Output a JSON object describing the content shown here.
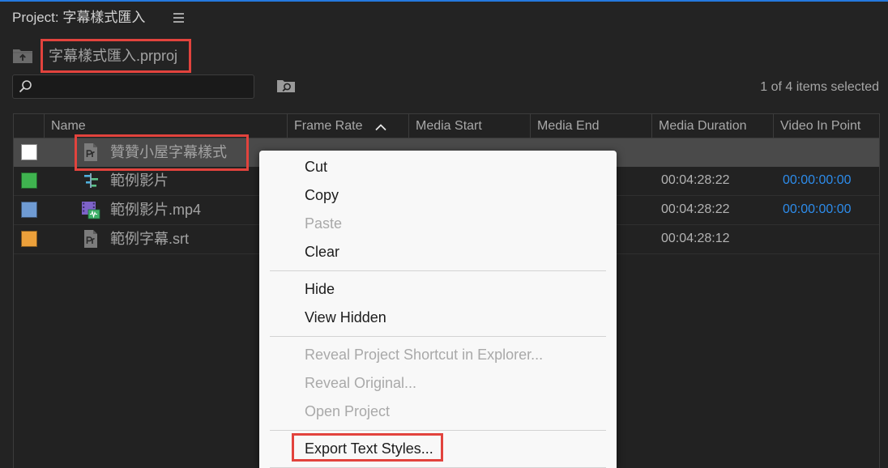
{
  "panel": {
    "title": "Project: 字幕樣式匯入",
    "menu_icon": "hamburger-menu-icon",
    "breadcrumb": {
      "icon": "parent-folder-icon",
      "label": "字幕樣式匯入.prproj",
      "annotated": true
    },
    "search": {
      "icon": "search-icon",
      "value": "",
      "placeholder": ""
    },
    "new_search_bin_icon": "new-search-bin-icon",
    "selection_status": "1 of 4 items selected"
  },
  "table": {
    "columns": [
      {
        "label": "Name"
      },
      {
        "label": "Frame Rate",
        "sort_icon": "chevron-up-icon"
      },
      {
        "label": "Media Start"
      },
      {
        "label": "Media End"
      },
      {
        "label": "Media Duration"
      },
      {
        "label": "Video In Point"
      }
    ],
    "rows": [
      {
        "label_color": "#ffffff",
        "icon": "premiere-file-icon",
        "name": "贊贊小屋字幕樣式",
        "media_duration": "",
        "video_in_point": "",
        "selected": true,
        "annotated": true
      },
      {
        "label_color": "#3fb34f",
        "icon": "sequence-icon",
        "name": "範例影片",
        "media_duration": "00:04:28:22",
        "video_in_point": "00:00:00:00",
        "selected": false
      },
      {
        "label_color": "#6f9bd3",
        "icon": "video-clip-icon",
        "name": "範例影片.mp4",
        "media_duration": "00:04:28:22",
        "video_in_point": "00:00:00:00",
        "selected": false
      },
      {
        "label_color": "#eca03a",
        "icon": "premiere-file-icon",
        "name": "範例字幕.srt",
        "media_duration": "00:04:28:12",
        "video_in_point": "",
        "selected": false
      }
    ]
  },
  "context_menu": {
    "groups": [
      {
        "items": [
          {
            "label": "Cut",
            "enabled": true
          },
          {
            "label": "Copy",
            "enabled": true
          },
          {
            "label": "Paste",
            "enabled": false
          },
          {
            "label": "Clear",
            "enabled": true
          }
        ]
      },
      {
        "items": [
          {
            "label": "Hide",
            "enabled": true
          },
          {
            "label": "View Hidden",
            "enabled": true
          }
        ]
      },
      {
        "items": [
          {
            "label": "Reveal Project Shortcut in Explorer...",
            "enabled": false
          },
          {
            "label": "Reveal Original...",
            "enabled": false
          },
          {
            "label": "Open Project",
            "enabled": false
          }
        ]
      },
      {
        "items": [
          {
            "label": "Export Text Styles...",
            "enabled": true,
            "annotated": true
          }
        ]
      }
    ]
  },
  "colors": {
    "panel_background": "#232323",
    "focus_border": "#2479df",
    "selected_row": "#4a4a4a",
    "timecode_link": "#2d8ceb",
    "menu_background": "#f8f8f8",
    "annotation_box": "#e2433d"
  }
}
